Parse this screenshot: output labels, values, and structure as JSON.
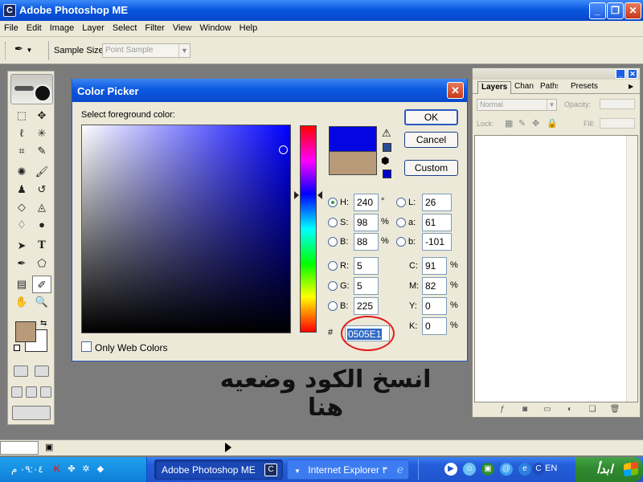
{
  "window": {
    "title": "Adobe Photoshop ME",
    "app_icon_label": "C"
  },
  "menu": [
    "File",
    "Edit",
    "Image",
    "Layer",
    "Select",
    "Filter",
    "View",
    "Window",
    "Help"
  ],
  "options_bar": {
    "sample_size_label": "Sample Size:",
    "sample_size_value": "Point Sample"
  },
  "toolbox": {
    "icons": [
      "marquee-tool-icon",
      "move-tool-icon",
      "lasso-tool-icon",
      "magic-wand-icon",
      "crop-tool-icon",
      "slice-tool-icon",
      "healing-brush-icon",
      "brush-tool-icon",
      "clone-stamp-icon",
      "history-brush-icon",
      "eraser-icon",
      "paint-bucket-icon",
      "blur-tool-icon",
      "dodge-tool-icon",
      "path-select-icon",
      "type-tool-icon",
      "pen-tool-icon",
      "shape-tool-icon",
      "notes-tool-icon",
      "eyedropper-icon",
      "hand-tool-icon",
      "zoom-tool-icon"
    ],
    "foreground_color": "#b89a78",
    "background_color": "#ffffff"
  },
  "layers_panel": {
    "tabs": [
      "Layers",
      "Channels",
      "Paths",
      "Presets"
    ],
    "blend_mode": "Normal",
    "opacity_label": "Opacity:",
    "lock_label": "Lock:",
    "fill_label": "Fill:"
  },
  "color_picker": {
    "title": "Color Picker",
    "prompt": "Select foreground color:",
    "buttons": {
      "ok": "OK",
      "cancel": "Cancel",
      "custom": "Custom"
    },
    "new_color": "#0505e1",
    "old_color": "#b89a78",
    "hsb": {
      "H_label": "H:",
      "H": "240",
      "H_unit": "°",
      "S_label": "S:",
      "S": "98",
      "S_unit": "%",
      "B_label": "B:",
      "B": "88",
      "B_unit": "%"
    },
    "lab": {
      "L_label": "L:",
      "L": "26",
      "a_label": "a:",
      "a": "61",
      "b_label": "b:",
      "b": "-101"
    },
    "rgb": {
      "R_label": "R:",
      "R": "5",
      "G_label": "G:",
      "G": "5",
      "B_label": "B:",
      "B": "225"
    },
    "cmyk": {
      "C_label": "C:",
      "C": "91",
      "M_label": "M:",
      "M": "82",
      "Y_label": "Y:",
      "Y": "0",
      "K_label": "K:",
      "K": "0",
      "unit": "%"
    },
    "hex_prefix": "#",
    "hex": "0505E1",
    "only_web_colors": "Only Web Colors"
  },
  "caption": "انسخ الكود وضعيه هنا",
  "taskbar": {
    "clock": "٠٩:٠٤ م",
    "tasks": [
      {
        "label": "Adobe Photoshop ME"
      },
      {
        "label": "Internet Explorer ٣"
      }
    ],
    "language": "EN",
    "start_label": "ابدأ"
  },
  "colors": {
    "xp_blue": "#0a58e0",
    "dialog_bg": "#ece9d8",
    "highlight_red": "#e41b1b",
    "workspace": "#7b7b7b"
  }
}
